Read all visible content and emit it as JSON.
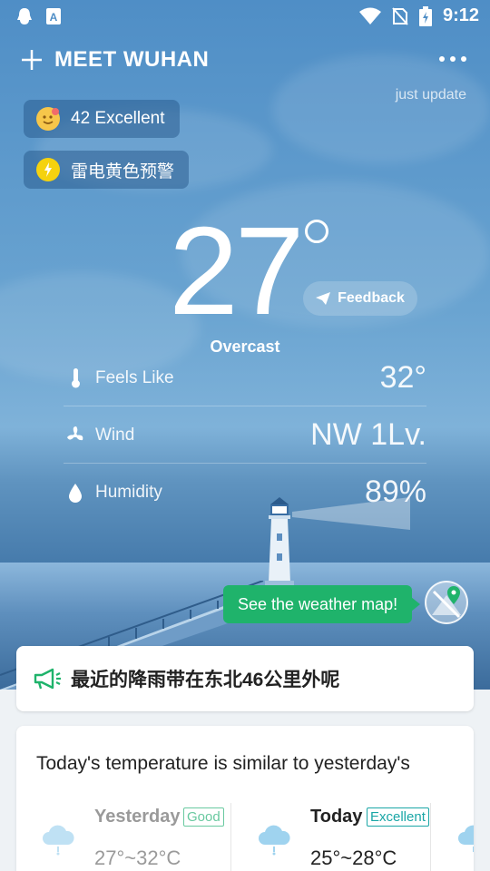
{
  "status": {
    "time": "9:12"
  },
  "header": {
    "city": "MEET WUHAN",
    "update_text": "just update"
  },
  "chips": {
    "aqi": "42 Excellent",
    "warning": "雷电黄色预警"
  },
  "current": {
    "temperature": "27",
    "condition": "Overcast",
    "feedback_label": "Feedback"
  },
  "details": [
    {
      "label": "Feels Like",
      "value": "32°"
    },
    {
      "label": "Wind",
      "value": "NW 1Lv."
    },
    {
      "label": "Humidity",
      "value": "89%"
    }
  ],
  "map_button": {
    "label": "See the weather map!"
  },
  "notice": {
    "text": "最近的降雨带在东北46公里外呢"
  },
  "compare": {
    "title": "Today's temperature is similar to yesterday's",
    "yesterday": {
      "name": "Yesterday",
      "badge": "Good",
      "range": "27°~32°C"
    },
    "today": {
      "name": "Today",
      "badge": "Excellent",
      "range": "25°~28°C"
    }
  },
  "colors": {
    "accent_green": "#1fb36b",
    "badge_good": "#69c9a0",
    "badge_excellent": "#1aa6a6",
    "icon_cloud": "#9fd3ef"
  }
}
